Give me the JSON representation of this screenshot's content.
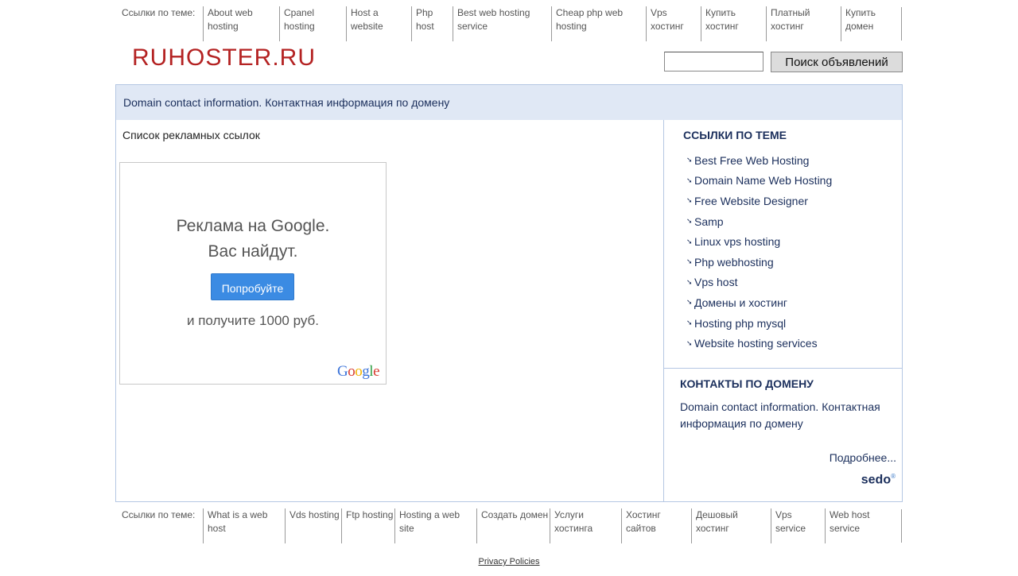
{
  "top_bar": {
    "caption": "Ссылки по теме:",
    "links": [
      "About web hosting",
      "Cpanel hosting",
      "Host a website",
      "Php host",
      "Best web hosting service",
      "Cheap php web hosting",
      "Vps хостинг",
      "Купить хостинг",
      "Платный хостинг",
      "Купить домен"
    ]
  },
  "header": {
    "logo": "RUHOSTER.RU",
    "search_value": "",
    "search_button": "Поиск объявлений"
  },
  "banner": "Domain contact information. Контактная информация по домену",
  "main": {
    "ads_title": "Список рекламных ссылок",
    "ad": {
      "line1": "Реклама на Google.",
      "line2": "Вас найдут.",
      "button": "Попробуйте",
      "line3": "и получите 1000 руб.",
      "brand": [
        "G",
        "o",
        "o",
        "g",
        "l",
        "e"
      ],
      "brand_colors": [
        "#3b73d9",
        "#d83b2f",
        "#f2b300",
        "#3b73d9",
        "#2f9e44",
        "#d83b2f"
      ]
    }
  },
  "sidebar": {
    "related_title": "ССЫЛКИ ПО ТЕМЕ",
    "related_links": [
      "Best Free Web Hosting",
      "Domain Name Web Hosting",
      "Free Website Designer",
      "Samp",
      "Linux vps hosting",
      "Php webhosting",
      "Vps host",
      "Домены и хостинг",
      "Hosting php mysql",
      "Website hosting services"
    ],
    "arrow_glyph": "➘",
    "contacts_title": "КОНТАКТЫ ПО ДОМЕНУ",
    "contacts_text": "Domain contact information. Контактная информация по домену",
    "more": "Подробнее...",
    "sedo": "sedo",
    "sedo_mark": "®"
  },
  "bottom_bar": {
    "caption": "Ссылки по теме:",
    "links": [
      "What is a web host",
      "Vds hosting",
      "Ftp hosting",
      "Hosting a web site",
      "Создать домен",
      "Услуги хостинга",
      "Хостинг сайтов",
      "Дешовый хостинг",
      "Vps service",
      "Web host service"
    ]
  },
  "footer": {
    "privacy": "Privacy Policies"
  },
  "colors": {
    "logo": "#b42222",
    "banner_bg": "#e0e8f5",
    "frame_border": "#b5c7e3",
    "link_text": "#1b2f5c",
    "ad_button": "#3b8be3"
  }
}
